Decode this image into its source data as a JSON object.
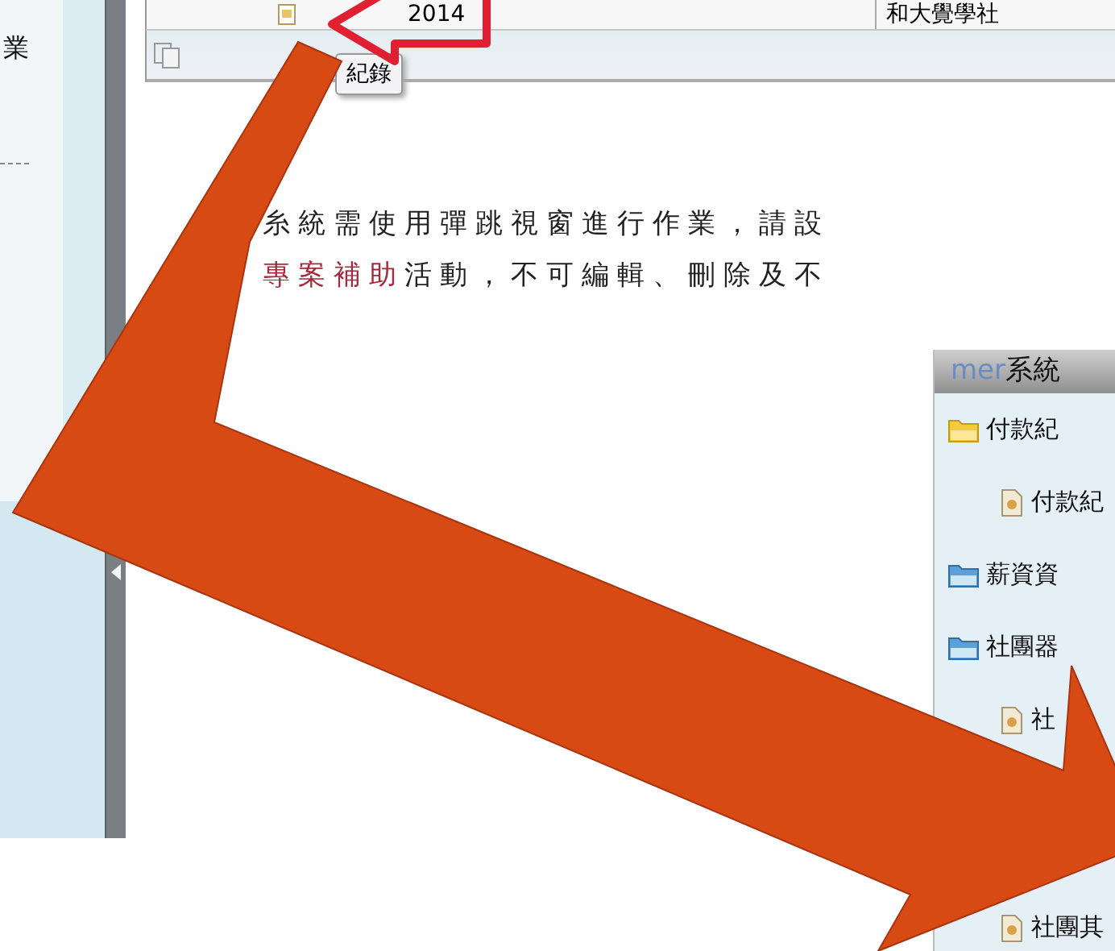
{
  "sidebar": {
    "items": [
      {
        "label": "業"
      }
    ]
  },
  "table": {
    "rows": [
      {
        "column_1": "2014",
        "column_2": "和大覺學社"
      }
    ]
  },
  "tooltip": {
    "label": "紀錄"
  },
  "notice": {
    "line_1": "糸統需使用彈跳視窗進行作業，請設",
    "line_2": {
      "highlight": "專案補助",
      "text": "活動，不可編輯、刪除及不"
    }
  },
  "panel": {
    "title_prefix": "mer",
    "title": "系統",
    "items": [
      {
        "label": "付款紀",
        "kind": "current",
        "children": [
          {
            "label": "付款紀",
            "kind": "file"
          }
        ]
      },
      {
        "label": "薪資資",
        "kind": "folder"
      },
      {
        "label": "社團器",
        "kind": "folder",
        "children": [
          {
            "label": "社",
            "kind": "file"
          },
          {
            "label": "社團其",
            "kind": "file"
          }
        ]
      }
    ]
  }
}
